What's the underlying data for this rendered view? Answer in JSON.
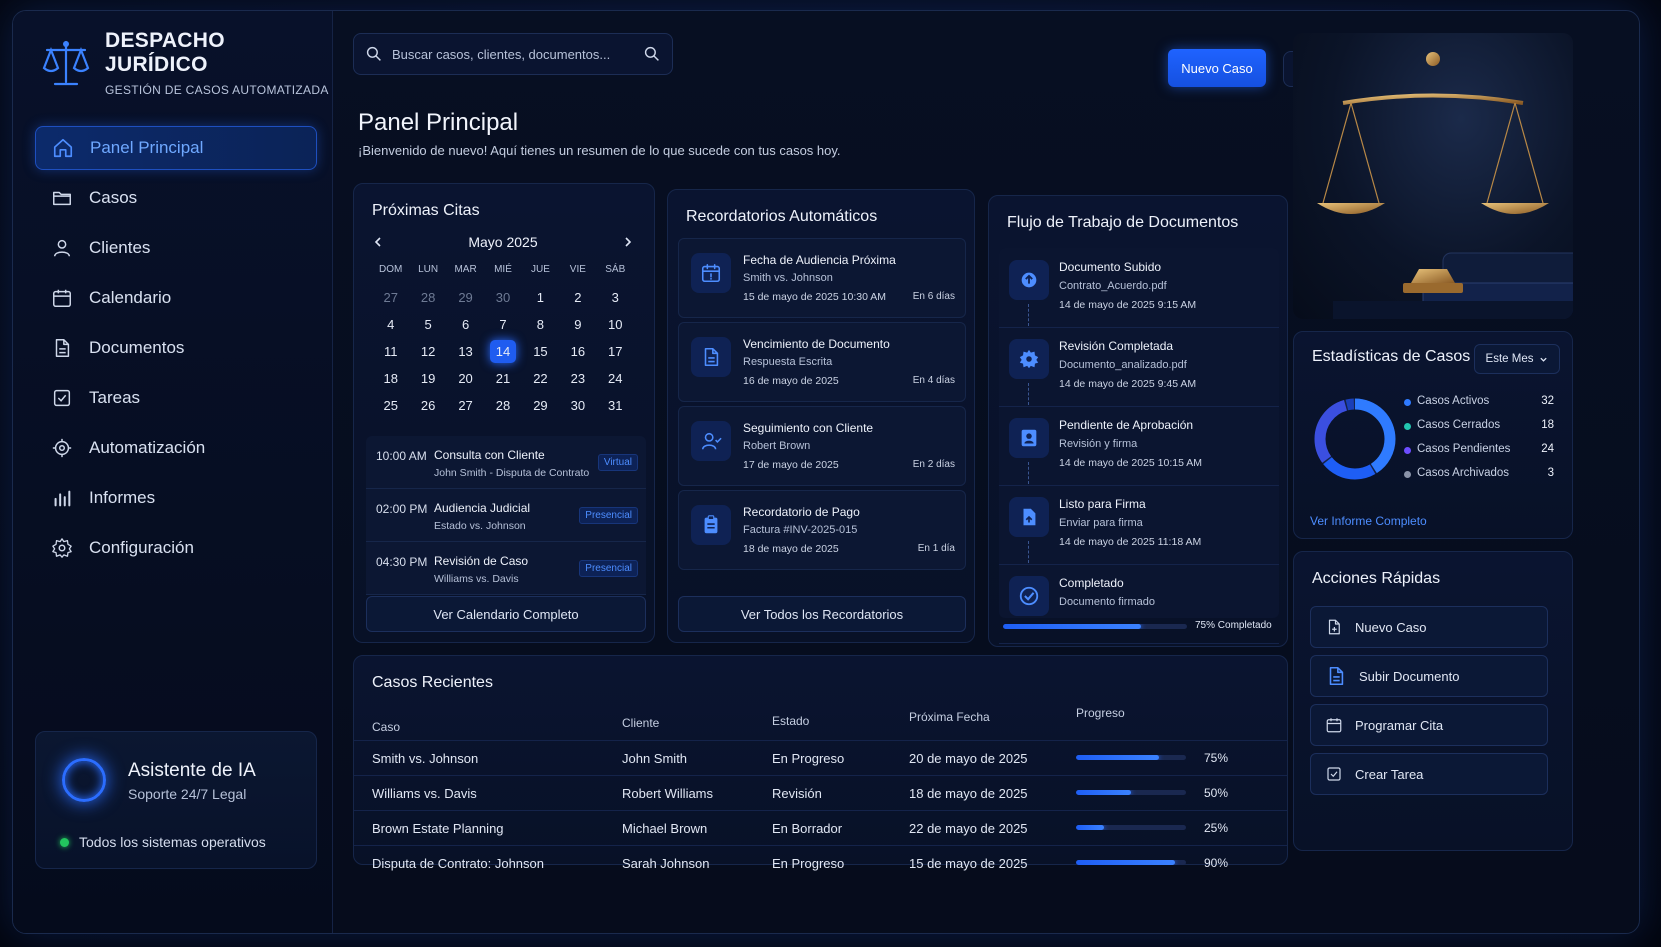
{
  "brand": {
    "title": "DESPACHO JURÍDICO",
    "subtitle": "GESTIÓN DE CASOS AUTOMATIZADA"
  },
  "sidebar": {
    "items": [
      {
        "label": "Panel Principal",
        "icon": "home-icon",
        "active": true
      },
      {
        "label": "Casos",
        "icon": "folder-icon"
      },
      {
        "label": "Clientes",
        "icon": "user-icon"
      },
      {
        "label": "Calendario",
        "icon": "calendar-icon"
      },
      {
        "label": "Documentos",
        "icon": "document-icon"
      },
      {
        "label": "Tareas",
        "icon": "checkbox-icon"
      },
      {
        "label": "Automatización",
        "icon": "automation-icon"
      },
      {
        "label": "Informes",
        "icon": "bar-chart-icon"
      },
      {
        "label": "Configuración",
        "icon": "gear-icon"
      }
    ],
    "assistant": {
      "title": "Asistente de IA",
      "subtitle": "Soporte 24/7 Legal",
      "status": "Todos los sistemas operativos"
    }
  },
  "topbar": {
    "search_placeholder": "Buscar casos, clientes, documentos...",
    "new_case": "Nuevo Caso"
  },
  "header": {
    "title": "Panel Principal",
    "subtitle": "¡Bienvenido de nuevo! Aquí tienes un resumen de lo que sucede con tus casos hoy."
  },
  "calendar": {
    "title": "Próximas Citas",
    "month": "Mayo 2025",
    "dow": [
      "DOM",
      "LUN",
      "MAR",
      "MIÉ",
      "JUE",
      "VIE",
      "SÁB"
    ],
    "days": [
      [
        "27",
        true
      ],
      [
        "28",
        true
      ],
      [
        "29",
        true
      ],
      [
        "30",
        true
      ],
      [
        "1"
      ],
      [
        "2"
      ],
      [
        "3"
      ],
      [
        "4"
      ],
      [
        "5"
      ],
      [
        "6"
      ],
      [
        "7"
      ],
      [
        "8"
      ],
      [
        "9"
      ],
      [
        "10"
      ],
      [
        "11"
      ],
      [
        "12"
      ],
      [
        "13"
      ],
      [
        "14",
        false,
        true
      ],
      [
        "15"
      ],
      [
        "16"
      ],
      [
        "17"
      ],
      [
        "18"
      ],
      [
        "19"
      ],
      [
        "20"
      ],
      [
        "21"
      ],
      [
        "22"
      ],
      [
        "23"
      ],
      [
        "24"
      ],
      [
        "25"
      ],
      [
        "26"
      ],
      [
        "27"
      ],
      [
        "28"
      ],
      [
        "29"
      ],
      [
        "30"
      ],
      [
        "31"
      ]
    ],
    "appointments": [
      {
        "time": "10:00 AM",
        "title": "Consulta con Cliente",
        "sub": "John Smith - Disputa de Contrato",
        "tag": "Virtual"
      },
      {
        "time": "02:00 PM",
        "title": "Audiencia Judicial",
        "sub": "Estado vs. Johnson",
        "tag": "Presencial"
      },
      {
        "time": "04:30 PM",
        "title": "Revisión de Caso",
        "sub": "Williams vs. Davis",
        "tag": "Presencial"
      }
    ],
    "button": "Ver Calendario Completo"
  },
  "reminders": {
    "title": "Recordatorios Automáticos",
    "items": [
      {
        "title": "Fecha de Audiencia Próxima",
        "sub": "Smith vs. Johnson",
        "date": "15 de mayo de 2025 10:30 AM",
        "in": "En 6 días",
        "icon": "calendar-alert-icon"
      },
      {
        "title": "Vencimiento de Documento",
        "sub": "Respuesta Escrita",
        "date": "16 de mayo de 2025",
        "in": "En 4 días",
        "icon": "document-icon"
      },
      {
        "title": "Seguimiento con Cliente",
        "sub": "Robert Brown",
        "date": "17 de mayo de 2025",
        "in": "En 2 días",
        "icon": "user-follow-icon"
      },
      {
        "title": "Recordatorio de Pago",
        "sub": "Factura #INV-2025-015",
        "date": "18 de mayo de 2025",
        "in": "En 1 día",
        "icon": "clipboard-icon"
      }
    ],
    "button": "Ver Todos los Recordatorios"
  },
  "workflow": {
    "title": "Flujo de Trabajo de Documentos",
    "steps": [
      {
        "title": "Documento Subido",
        "sub": "Contrato_Acuerdo.pdf",
        "date": "14 de mayo de 2025 9:15 AM",
        "icon": "upload-icon"
      },
      {
        "title": "Revisión Completada",
        "sub": "Documento_analizado.pdf",
        "date": "14 de mayo de 2025 9:45 AM",
        "icon": "gear-icon"
      },
      {
        "title": "Pendiente de Aprobación",
        "sub": "Revisión y firma",
        "date": "14 de mayo de 2025 10:15 AM",
        "icon": "approval-icon"
      },
      {
        "title": "Listo para Firma",
        "sub": "Enviar para firma",
        "date": "14 de mayo de 2025 11:18 AM",
        "icon": "signature-icon"
      },
      {
        "title": "Completado",
        "sub": "Documento firmado",
        "date": "",
        "icon": "check-circle-icon"
      }
    ],
    "progress": 0.75,
    "progress_label": "75% Completado"
  },
  "recent": {
    "title": "Casos Recientes",
    "headers": [
      "Caso",
      "Cliente",
      "Estado",
      "Próxima Fecha",
      "Progreso"
    ],
    "rows": [
      {
        "case": "Smith vs. Johnson",
        "client": "John Smith",
        "status": "En Progreso",
        "date": "20 de mayo de 2025",
        "progress": 0.75,
        "pct": "75%"
      },
      {
        "case": "Williams vs. Davis",
        "client": "Robert Williams",
        "status": "Revisión",
        "date": "18 de mayo de 2025",
        "progress": 0.5,
        "pct": "50%"
      },
      {
        "case": "Brown Estate Planning",
        "client": "Michael Brown",
        "status": "En Borrador",
        "date": "22 de mayo de 2025",
        "progress": 0.25,
        "pct": "25%"
      },
      {
        "case": "Disputa de Contrato: Johnson",
        "client": "Sarah Johnson",
        "status": "En Progreso",
        "date": "15 de mayo de 2025",
        "progress": 0.9,
        "pct": "90%"
      }
    ]
  },
  "stats": {
    "title": "Estadísticas de Casos",
    "period": "Este Mes",
    "items": [
      {
        "label": "Casos Activos",
        "value": 32,
        "color": "#2f7bff"
      },
      {
        "label": "Casos Cerrados",
        "value": 18,
        "color": "#22c5b0"
      },
      {
        "label": "Casos Pendientes",
        "value": 24,
        "color": "#6d4dff"
      },
      {
        "label": "Casos Archivados",
        "value": 3,
        "color": "#8a93a8"
      }
    ],
    "link": "Ver Informe Completo"
  },
  "quick": {
    "title": "Acciones Rápidas",
    "items": [
      {
        "label": "Nuevo Caso",
        "icon": "new-file-icon"
      },
      {
        "label": "Subir Documento",
        "icon": "document-icon"
      },
      {
        "label": "Programar Cita",
        "icon": "calendar-icon"
      },
      {
        "label": "Crear Tarea",
        "icon": "checkbox-icon"
      }
    ]
  },
  "colors": {
    "accent": "#1f63ff",
    "background": "#060c1c",
    "success": "#22c55e",
    "alert": "#ef4444"
  }
}
